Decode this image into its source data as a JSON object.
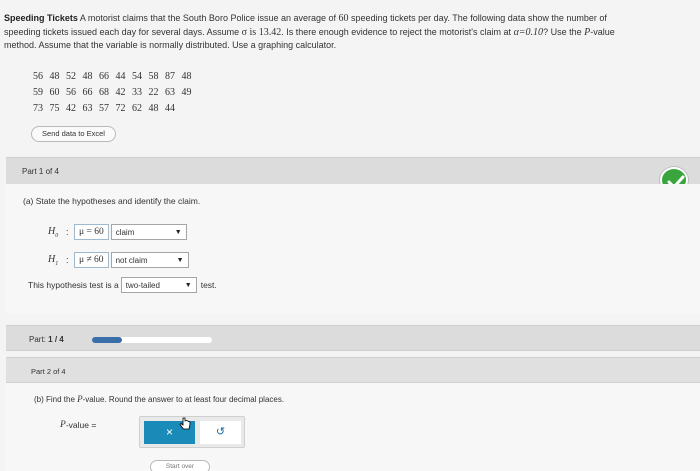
{
  "problem": {
    "title": "Speeding Tickets",
    "text_1": "A motorist claims that the South Boro Police issue an average of",
    "mean": "60",
    "text_2": "speeding tickets per day. The following data show the number of",
    "text_3": "speeding tickets issued each day for several days. Assume",
    "sigma_eq": "σ is 13.42",
    "text_4": ". Is there enough evidence to reject the motorist's claim at",
    "alpha_eq": "α=0.10",
    "text_5": "? Use the",
    "pvalue_word": "P",
    "text_6": "-value",
    "text_7": "method. Assume that the variable is normally distributed. Use a graphing calculator."
  },
  "data_rows": [
    [
      "56",
      "48",
      "52",
      "48",
      "66",
      "44",
      "54",
      "58",
      "87",
      "48"
    ],
    [
      "59",
      "60",
      "56",
      "66",
      "68",
      "42",
      "33",
      "22",
      "63",
      "49"
    ],
    [
      "73",
      "75",
      "42",
      "63",
      "57",
      "72",
      "62",
      "48",
      "44"
    ]
  ],
  "send_excel_label": "Send data to Excel",
  "part1": {
    "label": "Part 1 of 4",
    "question": "(a) State the hypotheses and identify the claim.",
    "h0": {
      "symbol": "H",
      "sub": "0",
      "expr": "μ = 60",
      "claim": "claim"
    },
    "h1": {
      "symbol": "H",
      "sub": "1",
      "expr": "μ ≠ 60",
      "claim": "not claim"
    },
    "test_prefix": "This hypothesis test is a",
    "test_value": "two-tailed",
    "test_suffix": "test."
  },
  "progress": {
    "label": "Part:",
    "value": "1 / 4",
    "fraction": 0.25
  },
  "part2": {
    "label": "Part 2 of 4",
    "question_1": "(b) Find the",
    "question_p": "P",
    "question_2": "-value. Round the answer to at least four decimal places.",
    "pvalue_label": "P",
    "pvalue_suffix": "-value ="
  },
  "buttons": {
    "clear": "×",
    "undo": "↺",
    "start_over": "Start over"
  },
  "colors": {
    "accent": "#1a8bb8",
    "success": "#3aa53d",
    "progress": "#3a6ea8"
  }
}
